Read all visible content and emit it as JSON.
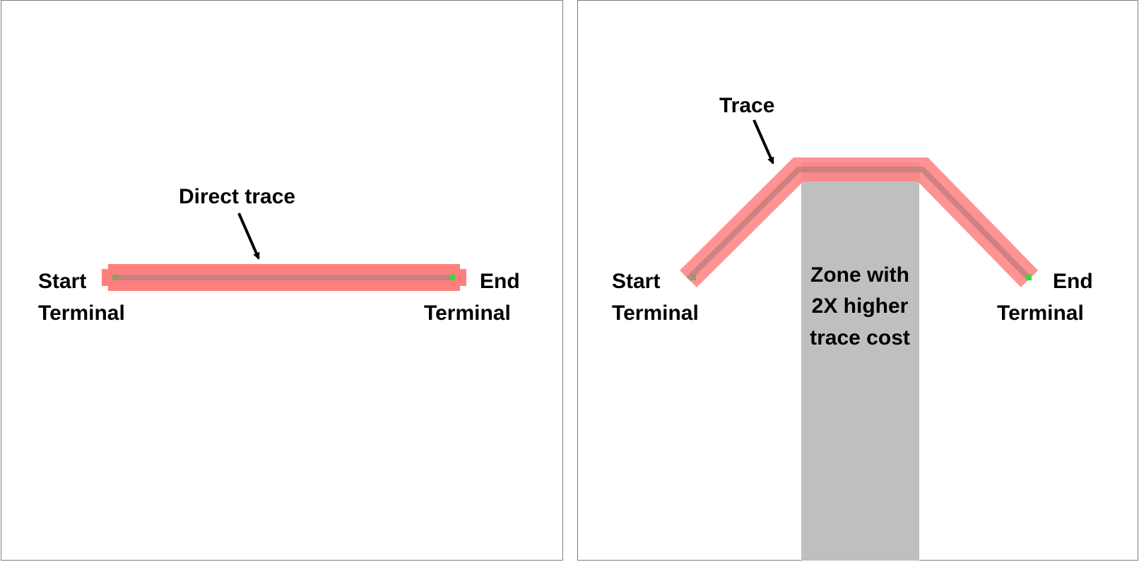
{
  "left_panel": {
    "start_label": [
      "Start",
      "Terminal"
    ],
    "end_label": [
      "End",
      "Terminal"
    ],
    "trace_label": "Direct trace"
  },
  "right_panel": {
    "start_label": [
      "Start",
      "Terminal"
    ],
    "end_label": [
      "End",
      "Terminal"
    ],
    "trace_label": "Trace",
    "zone_label": [
      "Zone with",
      "2X higher",
      "trace cost"
    ]
  },
  "colors": {
    "trace": "#ff7f7f",
    "trace_core": "#c98080",
    "zone": "#bfbfbf",
    "terminal_start": "#8a9f6a",
    "terminal_end": "#33dd33",
    "border": "#7f7f7f"
  }
}
